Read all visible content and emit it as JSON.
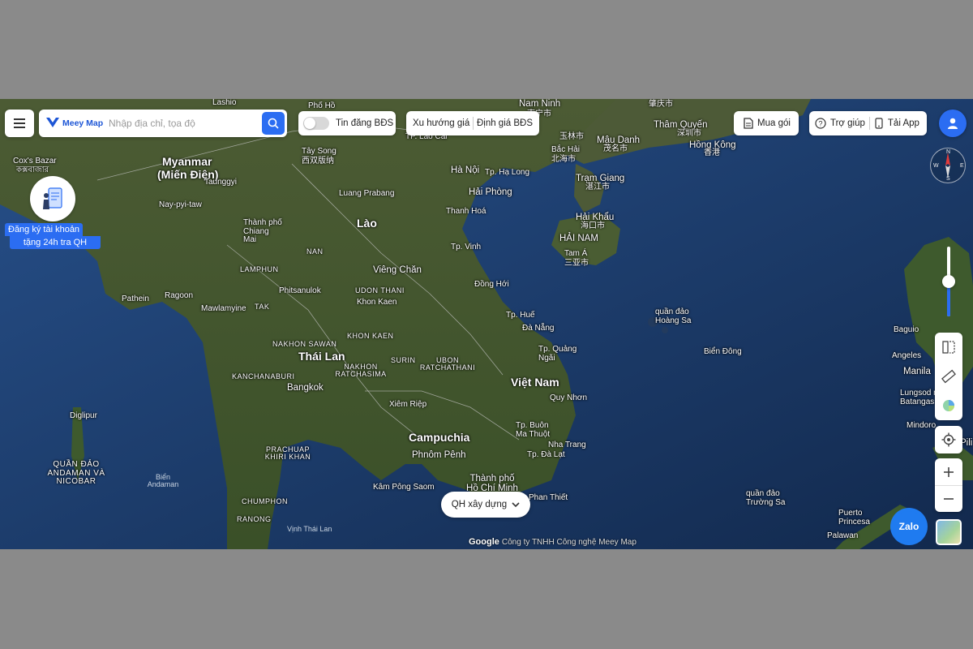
{
  "toolbar": {
    "logo_text": "Meey Map",
    "search": {
      "placeholder": "Nhập địa chỉ, tọa độ",
      "value": ""
    },
    "listing_toggle": {
      "label": "Tin đăng BĐS",
      "on": false
    },
    "trend_label": "Xu hướng giá",
    "valuation_label": "Định giá BĐS",
    "buy_label": "Mua gói",
    "help_label": "Trợ giúp",
    "app_label": "Tải App"
  },
  "promo": {
    "line1": "Đăng ký tài khoản",
    "line2": "tặng 24h tra QH"
  },
  "planning_button": {
    "label": "QH xây dựng"
  },
  "zalo_label": "Zalo",
  "attribution": {
    "google": "Google",
    "text": "Công ty TNHH Công nghệ Meey Map"
  },
  "compass": {
    "n": "N",
    "s": "S",
    "e": "E",
    "w": "W"
  },
  "zoom_level_fraction": 0.5,
  "colors": {
    "accent": "#2b6df2",
    "zalo": "#1f7bf0"
  },
  "map_labels": {
    "lashio": "Lashio",
    "phong_tho": "Phố Hồ",
    "nam_ninh": "Nam Ninh",
    "nam_ninh_zh": "南宁市",
    "zhaoqing": "肇庆市",
    "lao_cai": "TP. Lào Cai",
    "tham_quyen": "Thâm Quyến",
    "tham_quyen_zh": "深圳市",
    "hong_kong": "Hồng Kông",
    "hong_kong_zh": "香港",
    "yulin": "玉林市",
    "bac_hai": "Bắc Hải",
    "bac_hai_zh": "北海市",
    "mau_danh": "Mậu Danh",
    "mau_danh_zh": "茂名市",
    "myanmar": "Myanmar",
    "mien_dien": "(Miến Điện)",
    "coxs_bazar": "Cox's Bazar",
    "coxs_bazar_local": "কক্সবাজার",
    "taunggyi": "Taunggyi",
    "tay_song": "Tây Song",
    "tay_song_zh": "西双版纳",
    "ha_noi": "Hà Nội",
    "ha_long": "Tp. Hạ Long",
    "hai_phong": "Hải Phòng",
    "tram_giang": "Trạm Giang",
    "tram_giang_zh": "湛江市",
    "luang_prabang": "Luang Prabang",
    "thanh_hoa": "Thanh Hoá",
    "hai_khau": "Hải Khẩu",
    "hai_khau_zh": "海口市",
    "hai_nam": "HẢI NAM",
    "lao": "Lào",
    "nay_pyi_taw": "Nay-pyi-taw",
    "thanh_pho_chiang_mai": "Thành phố Chiang Mai",
    "tp_vinh": "Tp. Vinh",
    "tam_a": "Tam Á",
    "tam_a_zh": "三亚市",
    "lamphun": "LAMPHUN",
    "nan": "NAN",
    "vieng_chan": "Viêng Chăn",
    "udon_thani": "UDON THANI",
    "dong_hoi": "Đồng Hới",
    "pathein": "Pathein",
    "rangoon": "Ragoon",
    "phitsanulok": "Phitsanulok",
    "khon_kaen_city": "Khon Kaen",
    "hoang_sa": "quần đảo Hoàng Sa",
    "mawlamyine": "Mawlamyine",
    "tak": "TAK",
    "tp_hue": "Tp. Huế",
    "da_nang": "Đà Nẵng",
    "nakhon_sawan": "NAKHON SAWAN",
    "khon_kaen": "KHON KAEN",
    "baguio": "Baguio",
    "thai_lan": "Thái Lan",
    "nakhon_ratchasima": "NAKHON RATCHASIMA",
    "surin": "SURIN",
    "ubon_ratchathani": "UBON RATCHATHANI",
    "tp_quang_ngai": "Tp. Quảng Ngãi",
    "bien_dong": "Biển Đông",
    "angeles": "Angeles",
    "kanchanaburi": "KANCHANABURI",
    "manila": "Manila",
    "bangkok": "Bangkok",
    "viet_nam": "Việt Nam",
    "quy_nhon": "Quy Nhơn",
    "lungsod_ng_batangas": "Lungsod ng Batangas",
    "diglipur": "Diglipur",
    "xiem_riep": "Xiêm Riệp",
    "campuchia": "Campuchia",
    "buon_ma_thuot": "Tp. Buôn Ma Thuột",
    "mindoro": "Mindoro",
    "nha_trang": "Nha Trang",
    "phnom_penh": "Phnôm Pênh",
    "prachuap": "PRACHUAP KHIRI KHAN",
    "tp_da_lat": "Tp. Đà Lạt",
    "quan_dao_andaman": "QUẦN ĐẢO ANDAMAN VÀ NICOBAR",
    "bien_andaman": "Biển Andaman",
    "thanh_pho_hcm": "Thành phố Hồ Chí Minh",
    "kam_pong_sao": "Kâm Pông Saom",
    "phan_thiet": "Phan Thiết",
    "chumphon": "CHUMPHON",
    "quan_dao_truong_sa": "quần đảo Trường Sa",
    "puerto_princesa": "Puerto Princesa",
    "ranong": "RANONG",
    "vinh_thai_lan": "Vịnh Thái Lan",
    "palawan": "Palawan",
    "pili": "Pili"
  }
}
